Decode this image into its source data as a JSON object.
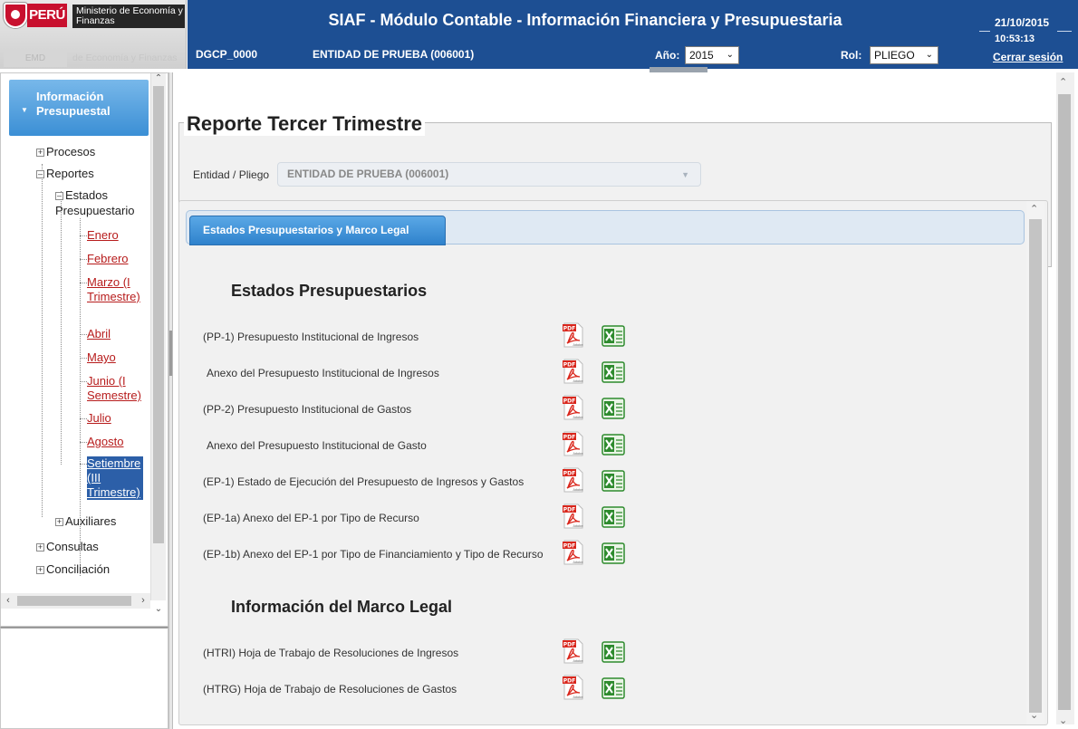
{
  "header": {
    "logo_country": "PERÚ",
    "logo_ministry": "Ministerio de Economía y Finanzas",
    "logo_ghost_text": "de Economía y Finanzas",
    "logo_ghost_abbr": "EMD",
    "title": "SIAF - Módulo Contable - Información Financiera y Presupuestaria",
    "user_code": "DGCP_0000",
    "entity": "ENTIDAD DE PRUEBA (006001)",
    "year_label": "Año:",
    "year_value": "2015",
    "role_label": "Rol:",
    "role_value": "PLIEGO",
    "date": "21/10/2015",
    "time": "10:53:13",
    "logout": "Cerrar sesión"
  },
  "sidebar": {
    "accordion_title": "Información Presupuestal",
    "nodes": {
      "procesos": "Procesos",
      "reportes": "Reportes",
      "estados": "Estados Presupuestario",
      "auxiliares": "Auxiliares",
      "consultas": "Consultas",
      "conciliacion": "Conciliación"
    },
    "months": [
      "Enero",
      "Febrero",
      "Marzo (I Trimestre)",
      "Abril",
      "Mayo",
      "Junio (I Semestre)",
      "Julio",
      "Agosto",
      "Setiembre (III Trimestre)"
    ],
    "active_month": "Setiembre (III Trimestre)"
  },
  "main": {
    "page_title": "Reporte Tercer Trimestre",
    "entity_label": "Entidad / Pliego",
    "entity_value": "ENTIDAD DE PRUEBA (006001)",
    "tab_label": "Estados Presupuestarios y Marco Legal",
    "section1_title": "Estados Presupuestarios",
    "section1_rows": [
      "(PP-1) Presupuesto Institucional de Ingresos",
      "Anexo del Presupuesto Institucional de Ingresos",
      "(PP-2) Presupuesto Institucional de Gastos",
      "Anexo del Presupuesto Institucional de Gasto",
      "(EP-1) Estado de Ejecución del Presupuesto de Ingresos y Gastos",
      "(EP-1a) Anexo del EP-1 por Tipo de Recurso",
      "(EP-1b) Anexo del EP-1 por Tipo de Financiamiento y Tipo de Recurso"
    ],
    "section2_title": "Información del Marco Legal",
    "section2_rows": [
      "(HTRI) Hoja de Trabajo de Resoluciones de Ingresos",
      "(HTRG) Hoja de Trabajo de Resoluciones de Gastos"
    ],
    "icon_pdf_text": "PDF",
    "icon_pdf_sub": "Adobe"
  },
  "colors": {
    "topbar": "#1d4f93",
    "accent": "#3b8fd5",
    "link": "#b71c1c",
    "active": "#2c5fa8"
  }
}
